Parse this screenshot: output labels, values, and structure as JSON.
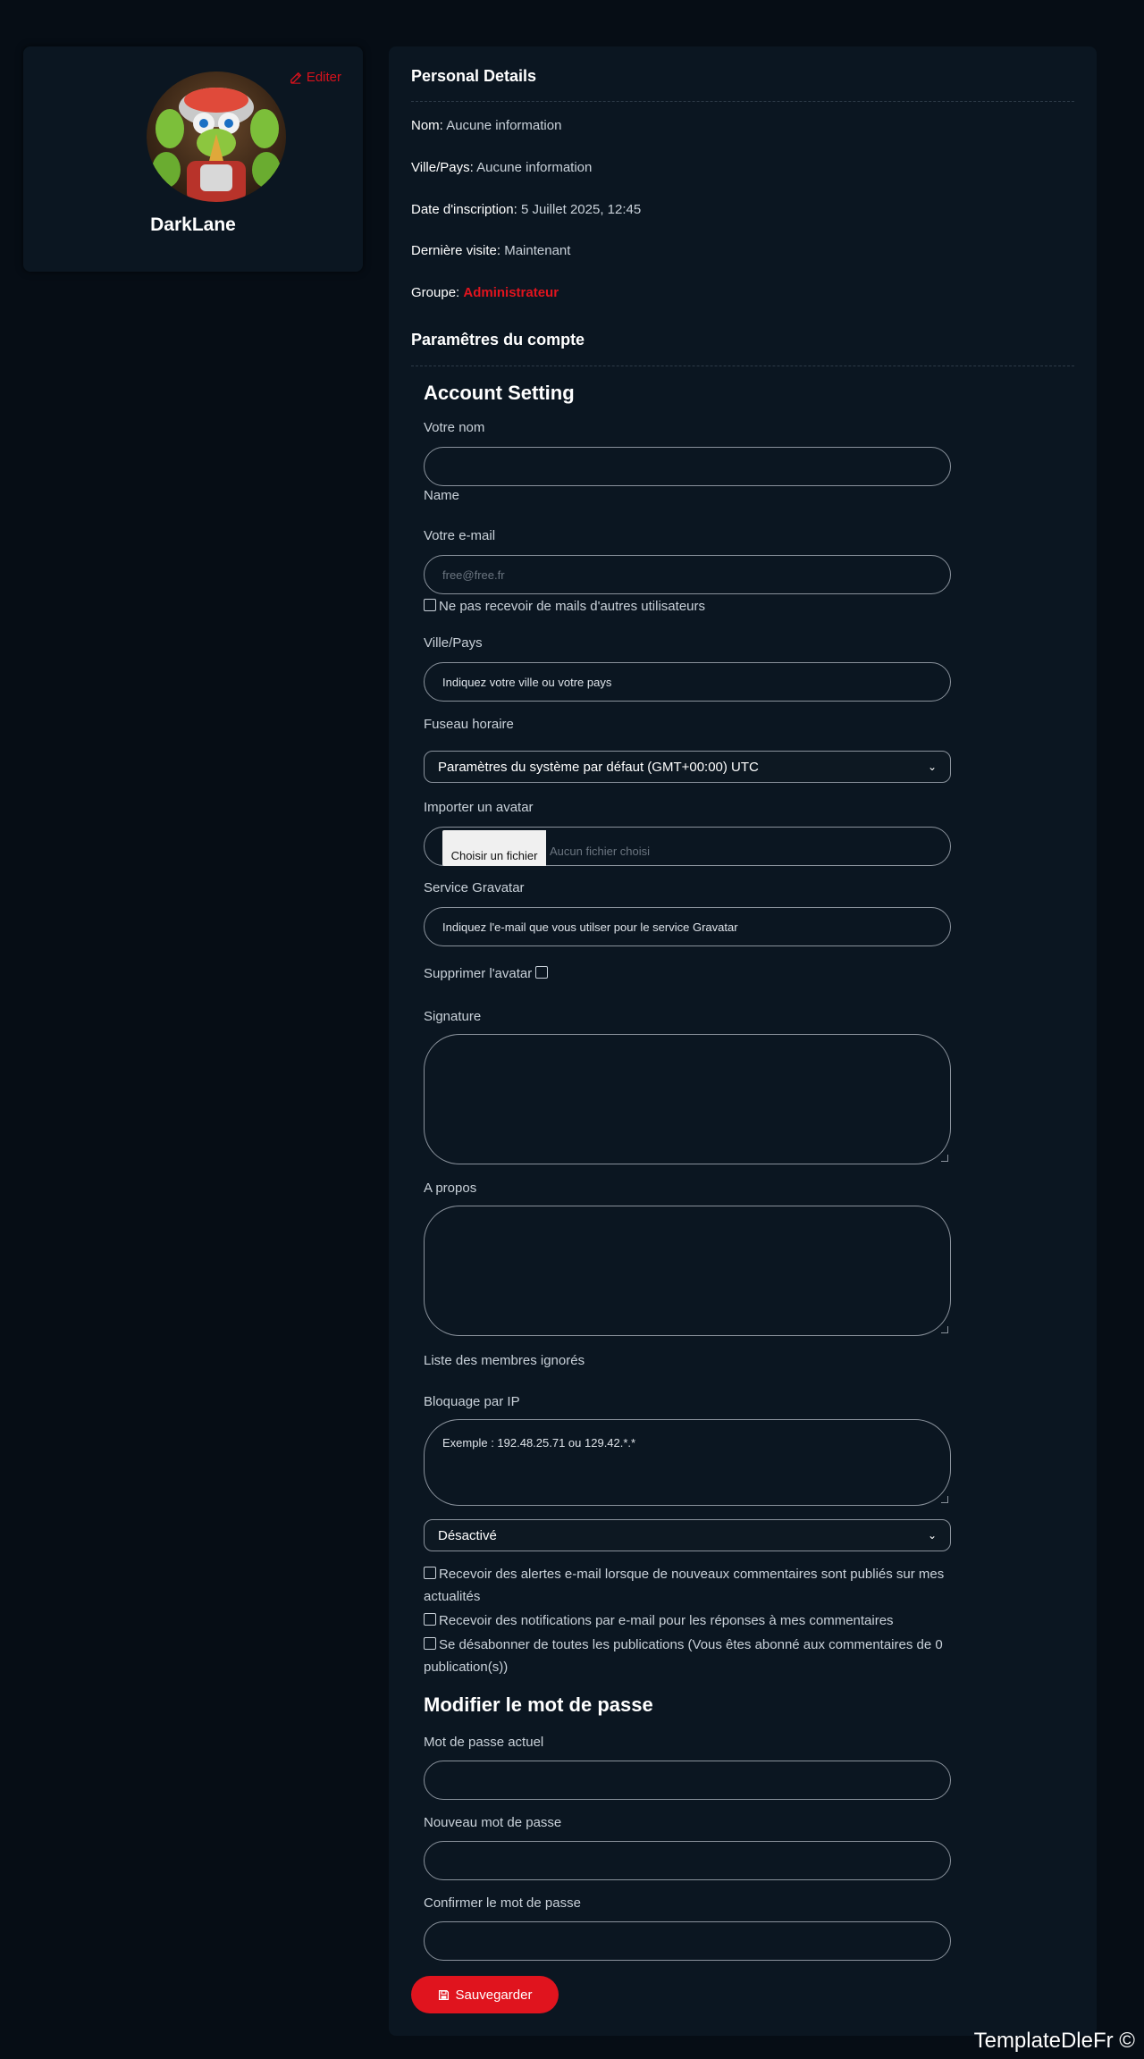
{
  "profile": {
    "edit_label": "Editer",
    "username": "DarkLane"
  },
  "personal": {
    "title": "Personal Details",
    "nom_label": "Nom:",
    "nom_value": "Aucune information",
    "ville_label": "Ville/Pays:",
    "ville_value": "Aucune information",
    "date_label": "Date d'inscription:",
    "date_value": "5 Juillet 2025, 12:45",
    "visite_label": "Dernière visite:",
    "visite_value": "Maintenant",
    "groupe_label": "Groupe:",
    "groupe_value": "Administrateur"
  },
  "account": {
    "section_title": "Paramêtres du compte",
    "heading": "Account Setting",
    "name_label": "Votre nom",
    "name_value": "",
    "name_hint": "Name",
    "email_label": "Votre e-mail",
    "email_placeholder": "free@free.fr",
    "no_mail_label": "Ne pas recevoir de mails d'autres utilisateurs",
    "ville_label": "Ville/Pays",
    "ville_value": "Indiquez votre ville ou votre pays",
    "timezone_label": "Fuseau horaire",
    "timezone_value": "Paramètres du système par défaut (GMT+00:00) UTC",
    "avatar_label": "Importer un avatar",
    "file_button": "Choisir un fichier",
    "file_none": "Aucun fichier choisi",
    "gravatar_label": "Service Gravatar",
    "gravatar_value": "Indiquez l'e-mail que vous utilser pour le service Gravatar",
    "delete_avatar_label": "Supprimer l'avatar",
    "signature_label": "Signature",
    "signature_value": "",
    "about_label": "A propos",
    "about_value": "",
    "ignored_label": "Liste des membres ignorés",
    "ip_label": "Bloquage par IP",
    "ip_value": "Exemple : 192.48.25.71 ou 129.42.*.*",
    "ip_select_value": "Désactivé",
    "alert_comments": "Recevoir des alertes e-mail lorsque de nouveaux commentaires sont publiés sur mes actualités",
    "notify_replies": "Recevoir des notifications par e-mail pour les réponses à mes commentaires",
    "unsubscribe": "Se désabonner de toutes les publications (Vous êtes abonné aux commentaires de 0 publication(s))"
  },
  "password": {
    "heading": "Modifier le mot de passe",
    "current_label": "Mot de passe actuel",
    "new_label": "Nouveau mot de passe",
    "confirm_label": "Confirmer le mot de passe"
  },
  "save_label": "Sauvegarder",
  "footer": "TemplateDleFr ©",
  "colors": {
    "background": "#060d15",
    "card": "#0b1621",
    "accent": "#e0141e"
  }
}
